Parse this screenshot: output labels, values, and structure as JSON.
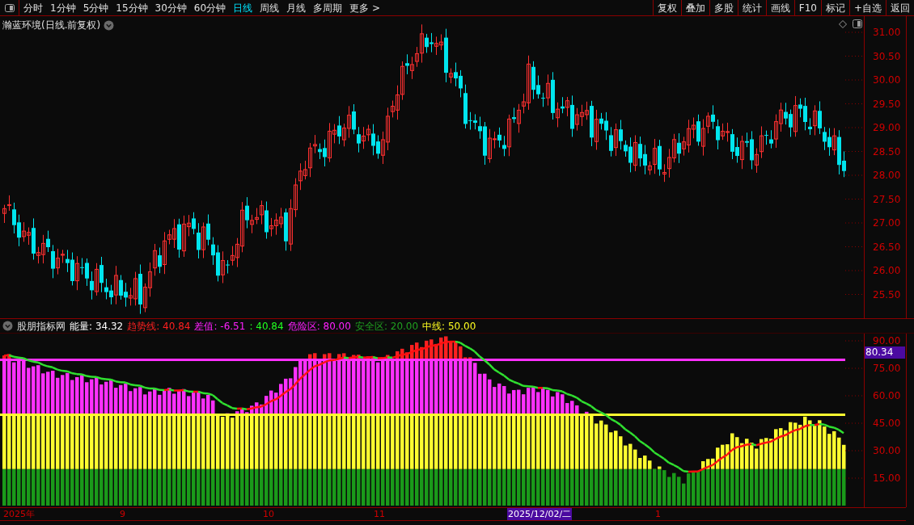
{
  "toolbar": {
    "periods": [
      {
        "label": "分时",
        "selected": false
      },
      {
        "label": "1分钟",
        "selected": false
      },
      {
        "label": "5分钟",
        "selected": false
      },
      {
        "label": "15分钟",
        "selected": false
      },
      {
        "label": "30分钟",
        "selected": false
      },
      {
        "label": "60分钟",
        "selected": false
      },
      {
        "label": "日线",
        "selected": true
      },
      {
        "label": "周线",
        "selected": false
      },
      {
        "label": "月线",
        "selected": false
      },
      {
        "label": "多周期",
        "selected": false
      },
      {
        "label": "更多 >",
        "selected": false
      }
    ],
    "actions": [
      "复权",
      "叠加",
      "多股",
      "统计",
      "画线",
      "F10",
      "标记",
      "+自选",
      "返回"
    ]
  },
  "price_panel": {
    "title": "瀚蓝环境(日线.前复权)",
    "axis_ticks": [
      "31.00",
      "30.50",
      "30.00",
      "29.50",
      "29.00",
      "28.50",
      "28.00",
      "27.50",
      "27.00",
      "26.50",
      "26.00",
      "25.50"
    ]
  },
  "indicator_panel": {
    "name": "股朋指标网",
    "readings": [
      {
        "label": "能量:",
        "value": "34.32",
        "color": "#ffffff"
      },
      {
        "label": "趋势线:",
        "value": "40.84",
        "color": "#ff2020"
      },
      {
        "label": "差值:",
        "value": "-6.51",
        "color": "#ff20ff"
      },
      {
        "label": ":",
        "value": "40.84",
        "color": "#20ff20"
      },
      {
        "label": "危险区:",
        "value": "80.00",
        "color": "#ff20ff"
      },
      {
        "label": "安全区:",
        "value": "20.00",
        "color": "#20a020"
      },
      {
        "label": "中线:",
        "value": "50.00",
        "color": "#ffff20"
      }
    ],
    "cursor_value": "80.34",
    "axis_ticks": [
      "90.00",
      "75.00",
      "60.00",
      "45.00",
      "30.00",
      "15.00"
    ]
  },
  "date_axis": {
    "labels": [
      {
        "text": "2025年",
        "selected": false
      },
      {
        "text": "9",
        "selected": false
      },
      {
        "text": "10",
        "selected": false
      },
      {
        "text": "11",
        "selected": false
      },
      {
        "text": "2025/12/02/二",
        "selected": true
      },
      {
        "text": "1",
        "selected": false
      }
    ]
  }
}
